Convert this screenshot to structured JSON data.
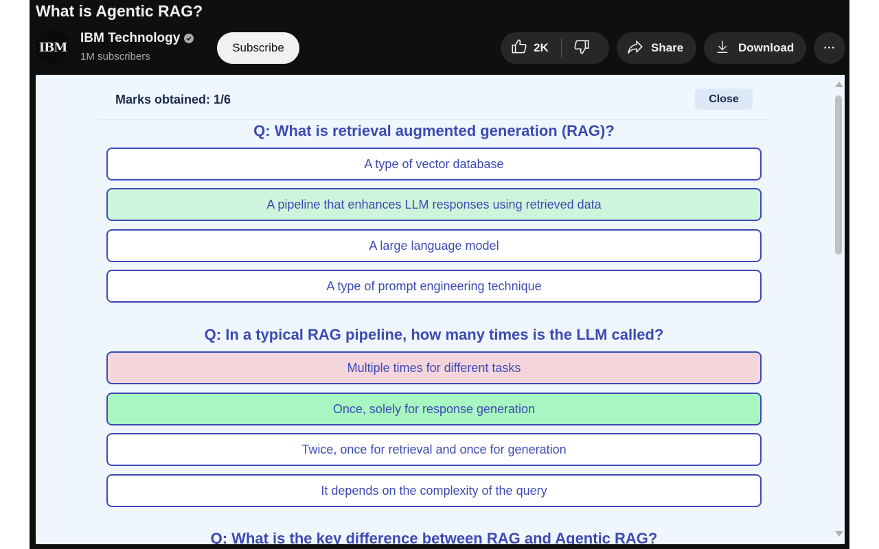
{
  "video": {
    "title": "What is Agentic RAG?"
  },
  "channel": {
    "avatar_text": "IBM",
    "name": "IBM Technology",
    "subscribers": "1M subscribers",
    "subscribe_label": "Subscribe"
  },
  "actions": {
    "like_count": "2K",
    "share_label": "Share",
    "download_label": "Download",
    "more_label": "···"
  },
  "quiz": {
    "marks_label": "Marks obtained: 1/6",
    "close_label": "Close",
    "questions": [
      {
        "text": "Q: What is retrieval augmented generation (RAG)?",
        "options": [
          {
            "text": "A type of vector database",
            "state": "neutral"
          },
          {
            "text": "A pipeline that enhances LLM responses using retrieved data",
            "state": "correct"
          },
          {
            "text": "A large language model",
            "state": "neutral"
          },
          {
            "text": "A type of prompt engineering technique",
            "state": "neutral"
          }
        ]
      },
      {
        "text": "Q: In a typical RAG pipeline, how many times is the LLM called?",
        "options": [
          {
            "text": "Multiple times for different tasks",
            "state": "wrong"
          },
          {
            "text": "Once, solely for response generation",
            "state": "correct"
          },
          {
            "text": "Twice, once for retrieval and once for generation",
            "state": "neutral"
          },
          {
            "text": "It depends on the complexity of the query",
            "state": "neutral"
          }
        ]
      },
      {
        "text": "Q: What is the key difference between RAG and Agentic RAG?"
      }
    ]
  },
  "colors": {
    "accent": "#3c4ab3",
    "correct_light": "#ccf5dc",
    "correct": "#a8f6c1",
    "wrong": "#f4d5db",
    "panel_bg": "#eff6fd"
  }
}
